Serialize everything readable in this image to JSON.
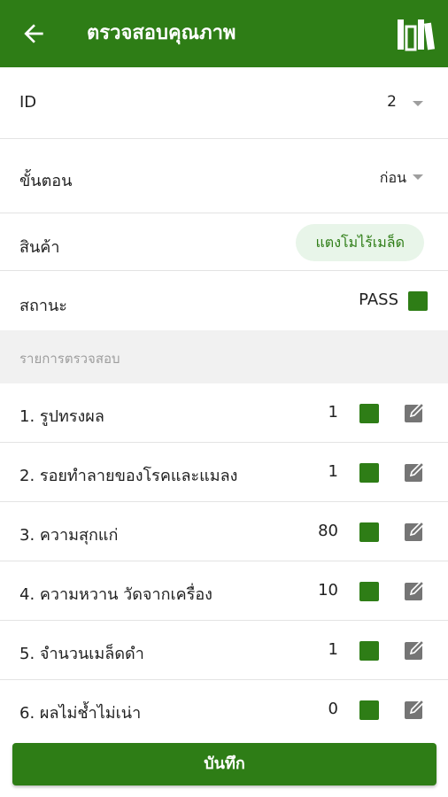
{
  "header": {
    "title": "ตรวจสอบคุณภาพ",
    "back_icon": "arrow-left-icon",
    "right_icon": "library-icon"
  },
  "form": {
    "id": {
      "label": "ID",
      "value": "2"
    },
    "step": {
      "label": "ขั้นตอน",
      "value": "ก่อน"
    },
    "product": {
      "label": "สินค้า",
      "value": "แตงโมไร้เมล็ด"
    },
    "status": {
      "label": "สถานะ",
      "value": "PASS"
    }
  },
  "checklist": {
    "title": "รายการตรวจสอบ",
    "items": [
      {
        "name": "1. รูปทรงผล",
        "value": "1"
      },
      {
        "name": "2. รอยทำลายของโรคและแมลง",
        "value": "1"
      },
      {
        "name": "3. ความสุกแก่",
        "value": "80"
      },
      {
        "name": "4. ความหวาน วัดจากเครื่อง",
        "value": "10"
      },
      {
        "name": "5. จำนวนเมล็ดดำ",
        "value": "1"
      },
      {
        "name": "6. ผลไม่ช้ำไม่เน่า",
        "value": "0"
      }
    ]
  },
  "save_label": "บันทึก",
  "colors": {
    "primary": "#2e7d16",
    "chip_bg": "#e8f5e9",
    "section_bg": "#f1f1f1"
  }
}
